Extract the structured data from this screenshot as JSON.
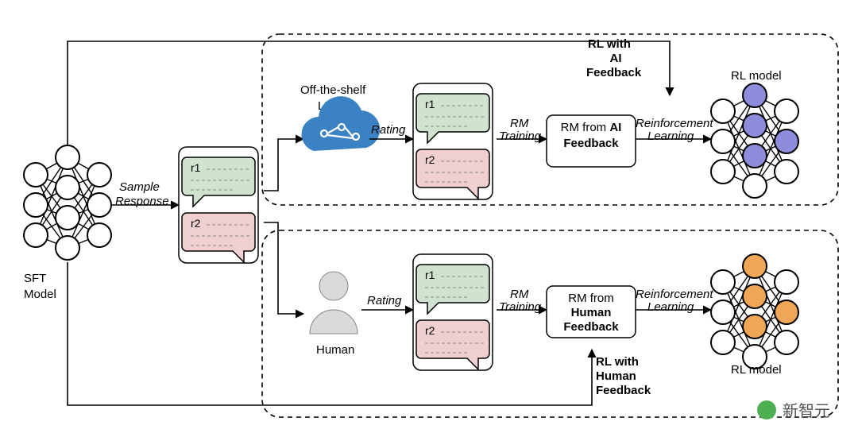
{
  "sft": {
    "label_l1": "SFT",
    "label_l2": "Model"
  },
  "sample": {
    "l1": "Sample",
    "l2": "Response"
  },
  "responses": {
    "r1": "r1",
    "r2": "r2"
  },
  "top": {
    "llm_l1": "Off-the-shelf",
    "llm_l2": "LLM",
    "rating": "Rating",
    "rm_training_l1": "RM",
    "rm_training_l2": "Training",
    "rm_box_l1": "RM from",
    "rm_box_l2_pre": "",
    "rm_box_l2_bold": "AI",
    "rm_box_l3": "Feedback",
    "rl_l1": "Reinforcement",
    "rl_l2": "Learning",
    "title_l1": "RL with",
    "title_l2": "AI",
    "title_l3": "Feedback",
    "rl_model": "RL model"
  },
  "bottom": {
    "human": "Human",
    "rating": "Rating",
    "rm_training_l1": "RM",
    "rm_training_l2": "Training",
    "rm_box_l1": "RM from",
    "rm_box_l2_bold": "Human",
    "rm_box_l3": "Feedback",
    "rl_l1": "Reinforcement",
    "rl_l2": "Learning",
    "title_l1": "RL with",
    "title_l2": "Human",
    "title_l3": "Feedback",
    "rl_model": "RL model"
  },
  "colors": {
    "bubble_green": "#cfe3cf",
    "bubble_green_stroke": "#6fa06f",
    "bubble_red": "#efcfcf",
    "bubble_red_stroke": "#c27b7b",
    "purple": "#8e8cdc",
    "orange": "#f0a657",
    "cloud": "#3b82c4"
  },
  "watermark": "新智元"
}
